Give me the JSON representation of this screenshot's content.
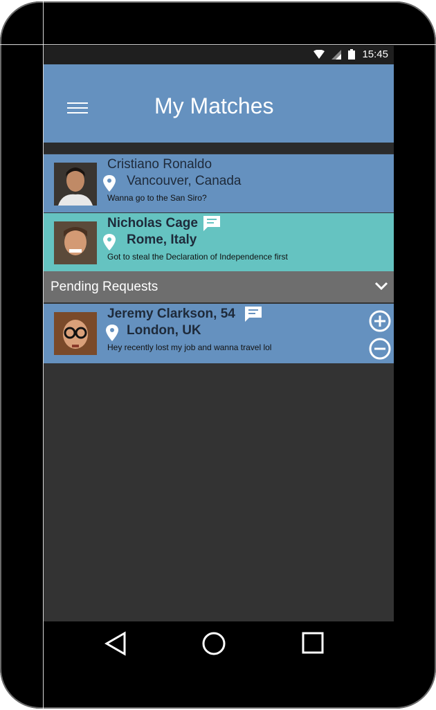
{
  "status_bar": {
    "time": "15:45"
  },
  "app_bar": {
    "title": "My Matches"
  },
  "matches": [
    {
      "name": "Cristiano Ronaldo",
      "location": "Vancouver, Canada",
      "message": "Wanna go to the San Siro?"
    },
    {
      "name": "Nicholas Cage",
      "location": "Rome, Italy",
      "message": "Got to steal the Declaration of Independence first"
    }
  ],
  "pending": {
    "label": "Pending Requests",
    "requests": [
      {
        "name": "Jeremy Clarkson, 54",
        "location": "London, UK",
        "message": "Hey recently lost my job and wanna travel lol"
      }
    ]
  },
  "icons": {
    "menu": "hamburger-icon",
    "location": "location-pin-icon",
    "chat": "chat-bubble-icon",
    "expand": "chevron-down-icon",
    "accept": "plus-circle-icon",
    "decline": "minus-circle-icon",
    "back": "back-triangle-icon",
    "home": "home-circle-icon",
    "recents": "recents-square-icon"
  },
  "colors": {
    "app_bar": "#6591bf",
    "highlight_row": "#65c3c1",
    "pending_bar": "#6e6e6e",
    "background": "#333333"
  }
}
